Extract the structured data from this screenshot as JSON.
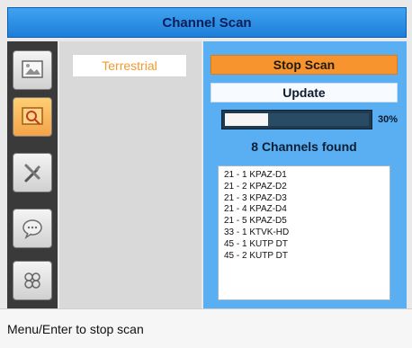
{
  "window": {
    "title": "Channel Scan"
  },
  "sidebar": {
    "icons": [
      {
        "name": "picture-settings-icon"
      },
      {
        "name": "channel-search-icon"
      },
      {
        "name": "tools-icon"
      },
      {
        "name": "chat-icon"
      },
      {
        "name": "apps-icon"
      }
    ]
  },
  "middle": {
    "tab_label": "Terrestrial"
  },
  "scan": {
    "stop_label": "Stop Scan",
    "update_label": "Update",
    "progress_percent": 30,
    "progress_label": "30%",
    "channels_found_label": "8 Channels found",
    "channels": [
      "21 - 1 KPAZ-D1",
      "21 - 2 KPAZ-D2",
      "21 - 3 KPAZ-D3",
      "21 - 4 KPAZ-D4",
      "21 - 5 KPAZ-D5",
      "33 - 1 KTVK-HD",
      "45 - 1 KUTP DT",
      "45 - 2 KUTP DT"
    ]
  },
  "status": {
    "hint": "Menu/Enter to stop scan"
  },
  "colors": {
    "title_bar": "#2b8fe6",
    "accent_orange": "#f7942e",
    "panel_blue": "#5aaef2"
  }
}
